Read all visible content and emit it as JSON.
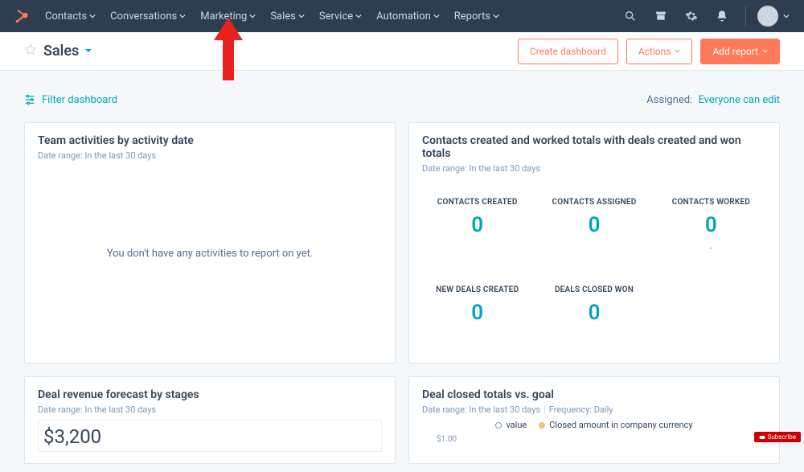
{
  "nav": {
    "items": [
      "Contacts",
      "Conversations",
      "Marketing",
      "Sales",
      "Service",
      "Automation",
      "Reports"
    ]
  },
  "subhead": {
    "title": "Sales",
    "create": "Create dashboard",
    "actions": "Actions",
    "add_report": "Add report"
  },
  "filter": {
    "label": "Filter dashboard",
    "assigned_label": "Assigned:",
    "assigned_value": "Everyone can edit"
  },
  "cards": {
    "team": {
      "title": "Team activities by activity date",
      "range": "Date range: In the last 30 days",
      "empty": "You don't have any activities to report on yet."
    },
    "contacts": {
      "title": "Contacts created and worked totals with deals created and won totals",
      "range": "Date range: In the last 30 days",
      "metrics": [
        {
          "label": "CONTACTS CREATED",
          "value": "0"
        },
        {
          "label": "CONTACTS ASSIGNED",
          "value": "0"
        },
        {
          "label": "CONTACTS WORKED",
          "value": "0",
          "dash": "-"
        },
        {
          "label": "NEW DEALS CREATED",
          "value": "0"
        },
        {
          "label": "DEALS CLOSED WON",
          "value": "0"
        }
      ]
    },
    "forecast": {
      "title": "Deal revenue forecast by stages",
      "range": "Date range: In the last 30 days",
      "value": "$3,200"
    },
    "closed": {
      "title": "Deal closed totals vs. goal",
      "range_prefix": "Date range: In the last 30 days",
      "freq": "Frequency: Daily",
      "legend_value": "value",
      "legend_closed": "Closed amount in company currency",
      "ytick": "$1.00"
    }
  },
  "badge": "Subscribe"
}
